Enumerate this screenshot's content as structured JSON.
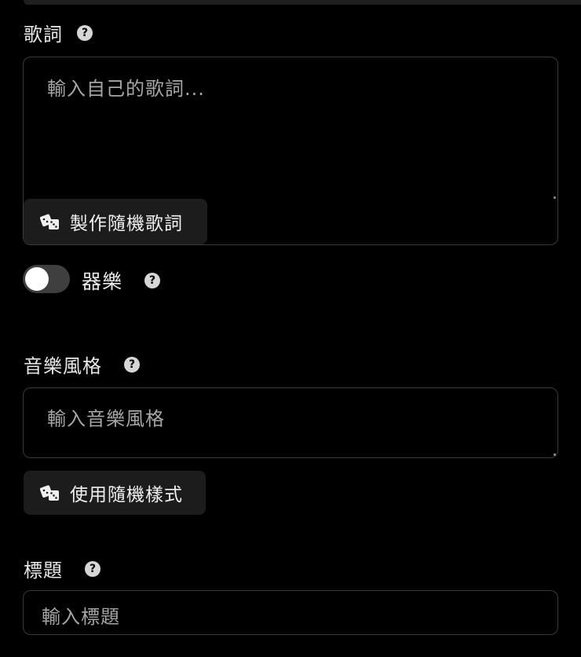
{
  "lyrics": {
    "label": "歌詞",
    "help_icon": "?",
    "placeholder": "輸入自己的歌詞...",
    "random_button": "製作隨機歌詞"
  },
  "instrumental": {
    "label": "器樂",
    "help_icon": "?",
    "enabled": false
  },
  "style": {
    "label": "音樂風格",
    "help_icon": "?",
    "placeholder": "輸入音樂風格",
    "random_button": "使用隨機樣式"
  },
  "title": {
    "label": "標題",
    "help_icon": "?",
    "placeholder": "輸入標題"
  },
  "colors": {
    "background": "#000000",
    "button_bg": "#1c1c1c",
    "border": "#3a3a3a",
    "toggle_off": "#3f3f3f"
  }
}
